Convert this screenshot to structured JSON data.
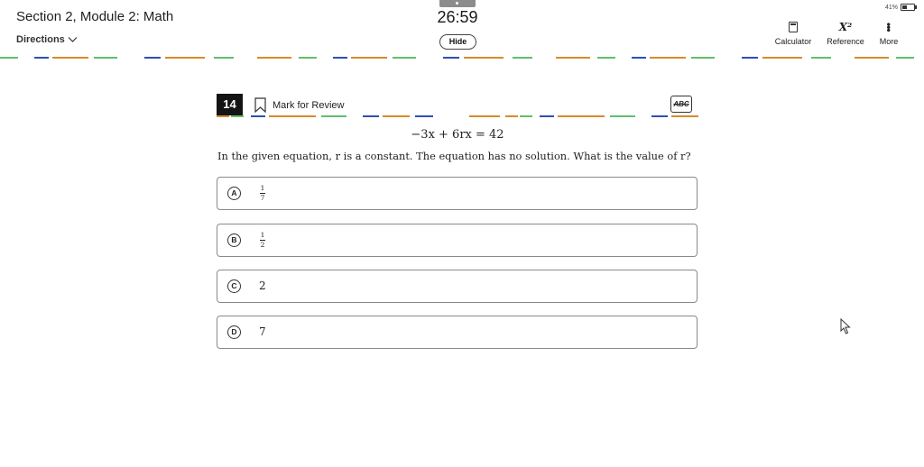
{
  "header": {
    "section_title": "Section 2, Module 2: Math",
    "directions_label": "Directions",
    "timer": "26:59",
    "hide_label": "Hide",
    "battery": "41%",
    "tools": {
      "calculator": "Calculator",
      "reference": "Reference",
      "reference_icon_text": "X²",
      "more": "More"
    }
  },
  "question": {
    "number": "14",
    "mark_for_review": "Mark for Review",
    "abc_label": "ABC",
    "equation": "−3x + 6rx = 42",
    "text": "In the given equation, r is a constant. The equation has no solution. What is the value of r?"
  },
  "choices": [
    {
      "letter": "A",
      "numerator": "1",
      "denominator": "7"
    },
    {
      "letter": "B",
      "numerator": "1",
      "denominator": "2"
    },
    {
      "letter": "C",
      "value": "2"
    },
    {
      "letter": "D",
      "value": "7"
    }
  ],
  "colors": {
    "dash_blue": "#2f4fb5",
    "dash_orange": "#d98a2b",
    "dash_green": "#5fbf6a",
    "dash_dark": "#3a3a3a"
  },
  "icons": [
    "chevron-down-icon",
    "battery-icon",
    "calculator-icon",
    "reference-icon",
    "more-icon",
    "bookmark-icon",
    "abc-strikethrough-icon",
    "mouse-cursor-icon"
  ]
}
